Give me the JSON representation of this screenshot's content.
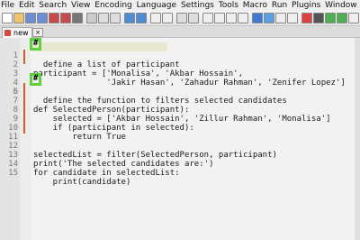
{
  "menu": [
    "File",
    "Edit",
    "Search",
    "View",
    "Encoding",
    "Language",
    "Settings",
    "Tools",
    "Macro",
    "Run",
    "Plugins",
    "Window",
    "?"
  ],
  "tab": {
    "label": "new"
  },
  "comment_mark": "#",
  "lines": [
    {
      "n": "1",
      "text": "  define a list of participant"
    },
    {
      "n": "2",
      "text": "participant = ['Monalisa', 'Akbar Hossain',"
    },
    {
      "n": "3",
      "text": "               'Jakir Hasan', 'Zahadur Rahman', 'Zenifer Lopez']"
    },
    {
      "n": "4",
      "text": ""
    },
    {
      "n": "5",
      "text": ""
    },
    {
      "n": "6",
      "text": "  define the function to filters selected candidates"
    },
    {
      "n": "7",
      "text": "def SelectedPerson(participant):"
    },
    {
      "n": "8",
      "text": "    selected = ['Akbar Hossain', 'Zillur Rahman', 'Monalisa']"
    },
    {
      "n": "9",
      "text": "    if (participant in selected):"
    },
    {
      "n": "10",
      "text": "        return True"
    },
    {
      "n": "11",
      "text": ""
    },
    {
      "n": "12",
      "text": "selectedList = filter(SelectedPerson, participant)"
    },
    {
      "n": "13",
      "text": "print('The selected candidates are:')"
    },
    {
      "n": "14",
      "text": "for candidate in selectedList:"
    },
    {
      "n": "15",
      "text": "    print(candidate)"
    }
  ],
  "colors": {
    "callout": "#5bd338",
    "fold_line": "#d06020"
  }
}
